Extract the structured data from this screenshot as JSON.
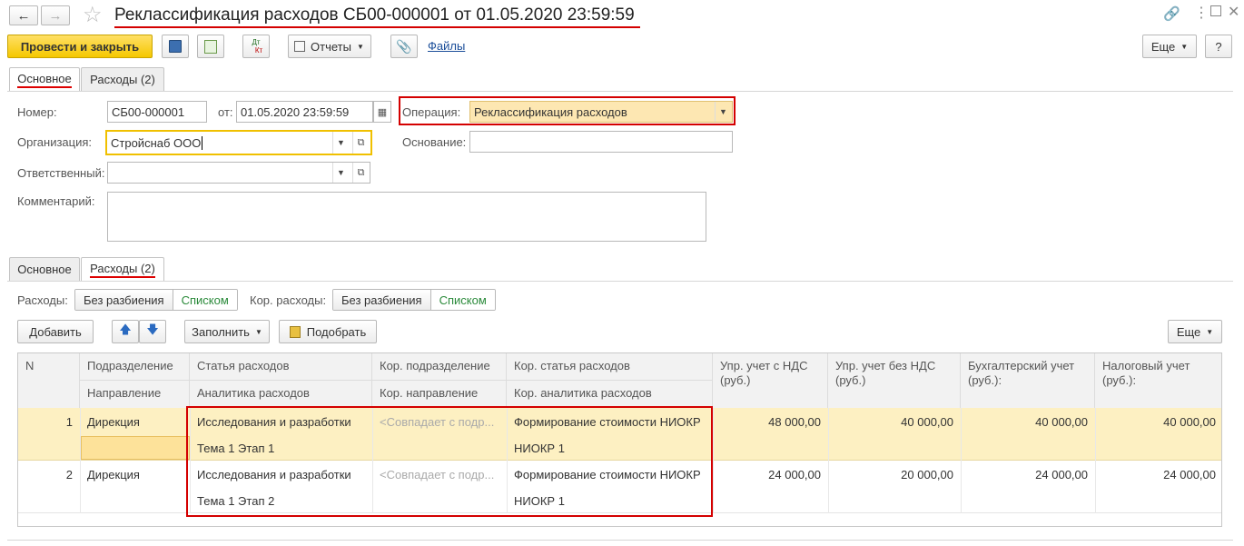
{
  "window": {
    "title": "Реклассификация расходов СБ00-000001 от 01.05.2020 23:59:59"
  },
  "toolbar": {
    "post_close": "Провести и закрыть",
    "reports": "Отчеты",
    "files": "Файлы",
    "more": "Еще",
    "help": "?",
    "dt_kt_top": "Дт",
    "dt_kt_bottom": "Кт"
  },
  "tabs_top": [
    {
      "label": "Основное"
    },
    {
      "label": "Расходы (2)"
    }
  ],
  "form": {
    "number_label": "Номер:",
    "number_value": "СБ00-000001",
    "date_label": "от:",
    "date_value": "01.05.2020 23:59:59",
    "operation_label": "Операция:",
    "operation_value": "Реклассификация расходов",
    "org_label": "Организация:",
    "org_value": "Стройснаб ООО",
    "basis_label": "Основание:",
    "basis_value": "",
    "resp_label": "Ответственный:",
    "resp_value": "",
    "comment_label": "Комментарий:",
    "comment_value": ""
  },
  "tabs_bottom": [
    {
      "label": "Основное"
    },
    {
      "label": "Расходы (2)"
    }
  ],
  "expenses": {
    "label": "Расходы:",
    "no_split": "Без разбиения",
    "list": "Списком",
    "kor_label": "Кор. расходы:",
    "kor_no_split": "Без разбиения",
    "kor_list": "Списком"
  },
  "table_toolbar": {
    "add": "Добавить",
    "fill": "Заполнить",
    "pick": "Подобрать",
    "more": "Еще"
  },
  "table": {
    "headers": {
      "n": "N",
      "dept": "Подразделение",
      "direction": "Направление",
      "item": "Статья расходов",
      "analytics": "Аналитика расходов",
      "kor_dept": "Кор. подразделение",
      "kor_direction": "Кор. направление",
      "kor_item": "Кор. статья расходов",
      "kor_analytics": "Кор. аналитика расходов",
      "mgmt_vat": "Упр. учет с НДС (руб.)",
      "mgmt_novat": "Упр. учет без НДС (руб.)",
      "acc": "Бухгалтерский учет (руб.):",
      "tax": "Налоговый учет (руб.):"
    },
    "rows": [
      {
        "n": "1",
        "dept": "Дирекция",
        "item": "Исследования и разработки",
        "analytics": "Тема 1 Этап 1",
        "kor_dept": "<Совпадает с подр...",
        "kor_item": "Формирование стоимости НИОКР",
        "kor_analytics": "НИОКР 1",
        "mgmt_vat": "48 000,00",
        "mgmt_novat": "40 000,00",
        "acc": "40 000,00",
        "tax": "40 000,00"
      },
      {
        "n": "2",
        "dept": "Дирекция",
        "item": "Исследования и разработки",
        "analytics": "Тема 1 Этап 2",
        "kor_dept": "<Совпадает с подр...",
        "kor_item": "Формирование стоимости НИОКР",
        "kor_analytics": "НИОКР 1",
        "mgmt_vat": "24 000,00",
        "mgmt_novat": "20 000,00",
        "acc": "24 000,00",
        "tax": "24 000,00"
      }
    ]
  },
  "colors": {
    "accent_red": "#d40000",
    "primary_yellow": "#f5c800",
    "selected_row": "#fdf0c2",
    "switch_active": "#2a8a3a"
  }
}
